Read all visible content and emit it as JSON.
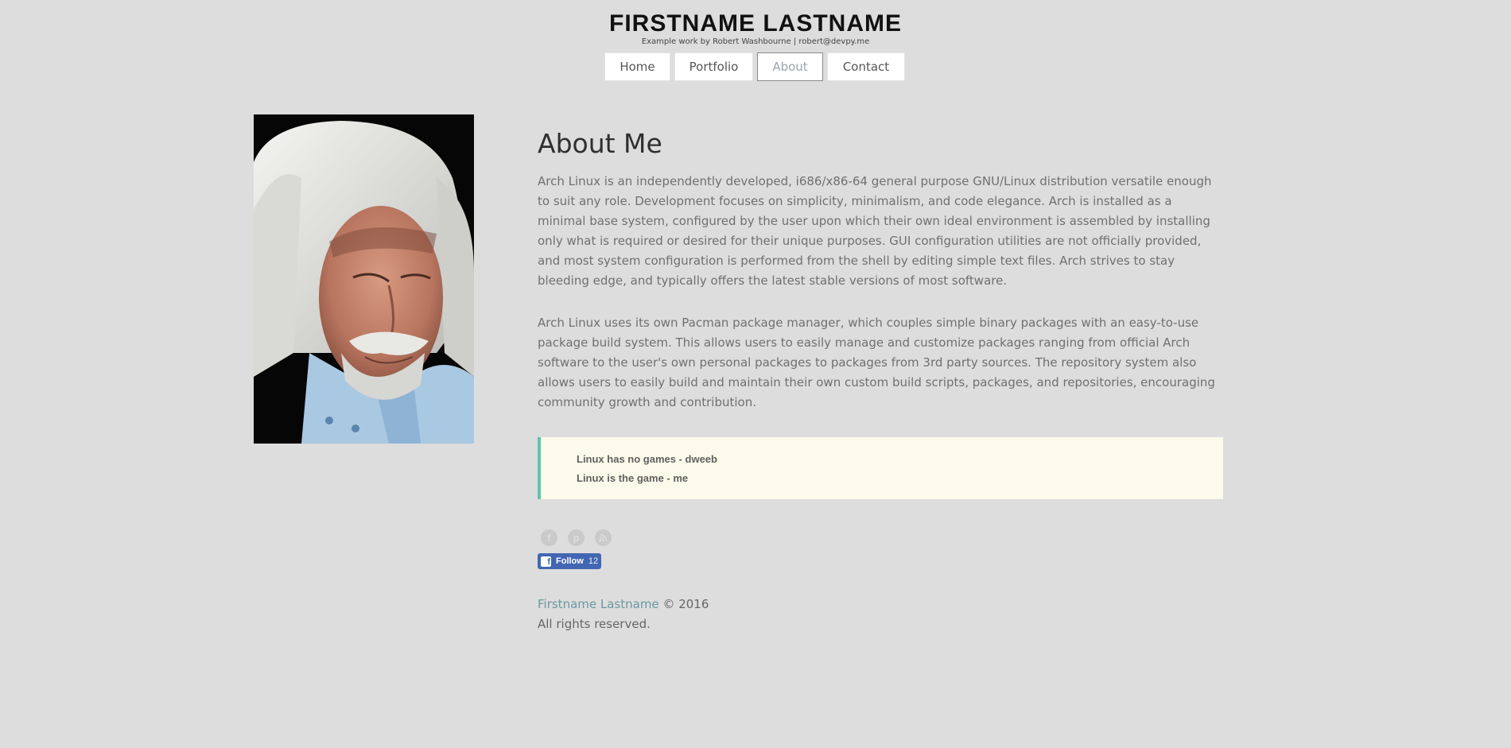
{
  "header": {
    "title": "FIRSTNAME LASTNAME",
    "subtitle": "Example work by Robert Washbourne | robert@devpy.me"
  },
  "nav": {
    "items": [
      {
        "label": "Home",
        "active": false
      },
      {
        "label": "Portfolio",
        "active": false
      },
      {
        "label": "About",
        "active": true
      },
      {
        "label": "Contact",
        "active": false
      }
    ]
  },
  "main": {
    "title": "About Me",
    "paragraphs": [
      "Arch Linux is an independently developed, i686/x86-64 general purpose GNU/Linux distribution versatile enough to suit any role. Development focuses on simplicity, minimalism, and code elegance. Arch is installed as a minimal base system, configured by the user upon which their own ideal environment is assembled by installing only what is required or desired for their unique purposes. GUI configuration utilities are not officially provided, and most system configuration is performed from the shell by editing simple text files. Arch strives to stay bleeding edge, and typically offers the latest stable versions of most software.",
      "Arch Linux uses its own Pacman package manager, which couples simple binary packages with an easy-to-use package build system. This allows users to easily manage and customize packages ranging from official Arch software to the user's own personal packages to packages from 3rd party sources. The repository system also allows users to easily build and maintain their own custom build scripts, packages, and repositories, encouraging community growth and contribution."
    ],
    "quote_lines": [
      "Linux has no games - dweeb",
      "Linux is the game - me"
    ]
  },
  "social": {
    "icons": [
      "facebook-icon",
      "pinterest-icon",
      "rss-icon"
    ],
    "facebook_follow": {
      "label": "Follow",
      "count": "12"
    }
  },
  "footer": {
    "link_text": "Firstname Lastname",
    "copyright": " © 2016",
    "rights": "All rights reserved."
  },
  "colors": {
    "background": "#dcdddc",
    "quote_border": "#5ec4b0",
    "quote_background": "#fcfaea",
    "link": "#6d97a3",
    "facebook": "#4267b2"
  }
}
